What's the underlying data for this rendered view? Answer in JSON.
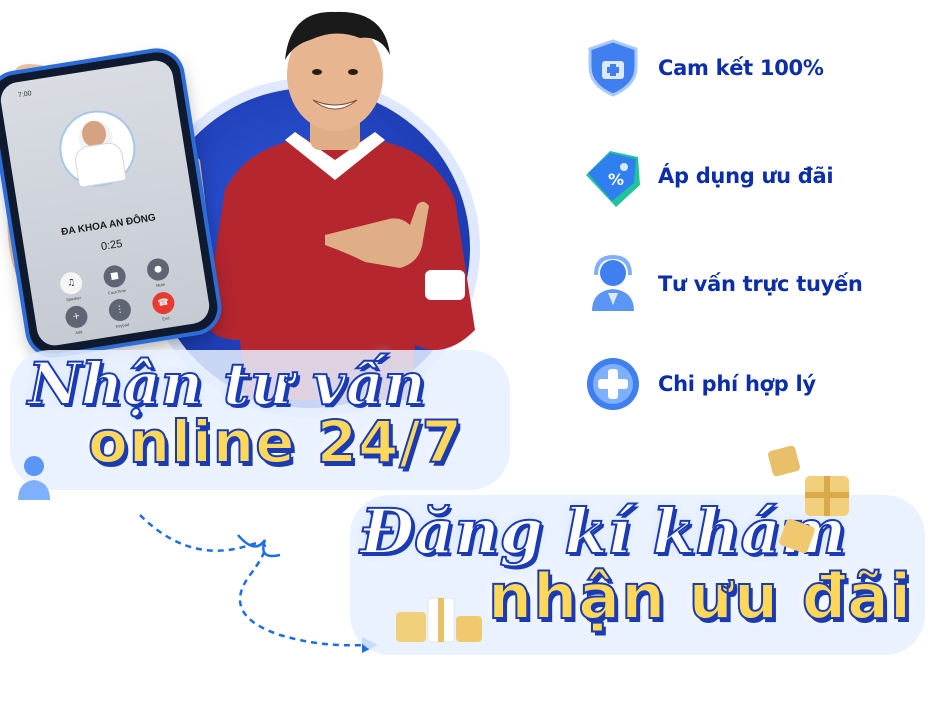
{
  "phone": {
    "status_time": "7:00",
    "caller_name": "ĐA KHOA AN ĐÔNG",
    "call_duration": "0:25",
    "buttons": [
      "Speaker",
      "FaceTime",
      "Mute",
      "Add",
      "Keypad",
      "End"
    ]
  },
  "features": [
    {
      "label": "Cam kết 100%",
      "icon": "shield-plus-icon"
    },
    {
      "label": "Áp dụng ưu đãi",
      "icon": "discount-tag-icon"
    },
    {
      "label": "Tư vấn trực tuyến",
      "icon": "support-agent-icon"
    },
    {
      "label": "Chi phí hợp lý",
      "icon": "medical-cross-icon"
    }
  ],
  "headline1": {
    "script": "Nhận tư vấn",
    "bold": "online 24/7"
  },
  "headline2": {
    "script": "Đăng kí khám",
    "bold": "nhận ưu đãi"
  },
  "colors": {
    "brand_blue": "#1b3bb5",
    "accent_yellow": "#ffd85a",
    "call_red": "#e63b2e"
  }
}
